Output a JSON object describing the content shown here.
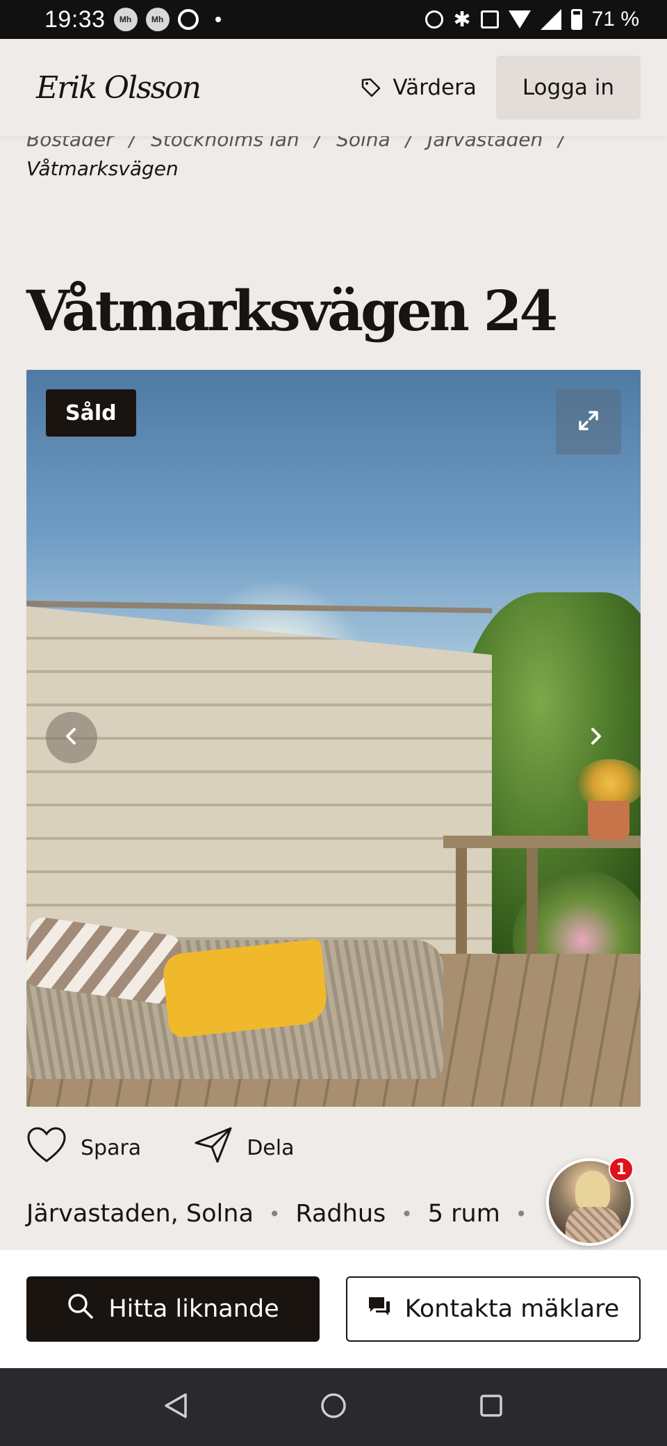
{
  "status_bar": {
    "time": "19:33",
    "notif_icons": [
      "Mh",
      "Mh"
    ],
    "battery": "71 %"
  },
  "header": {
    "logo": "Erik Olsson",
    "valuate_label": "Värdera",
    "login_label": "Logga in"
  },
  "breadcrumb": {
    "items": [
      "Bostäder",
      "Stockholms län",
      "Solna",
      "Järvastaden"
    ],
    "current": "Våtmarksvägen"
  },
  "listing": {
    "title": "Våtmarksvägen 24",
    "status_badge": "Såld",
    "area": "Järvastaden, Solna",
    "type": "Radhus",
    "rooms": "5 rum"
  },
  "actions": {
    "save_label": "Spara",
    "share_label": "Dela"
  },
  "agent": {
    "notification_count": "1"
  },
  "bottom_bar": {
    "find_similar_label": "Hitta liknande",
    "contact_label": "Kontakta mäklare"
  },
  "colors": {
    "background": "#efebe8",
    "primary": "#1a1410",
    "badge": "#e0121a"
  }
}
